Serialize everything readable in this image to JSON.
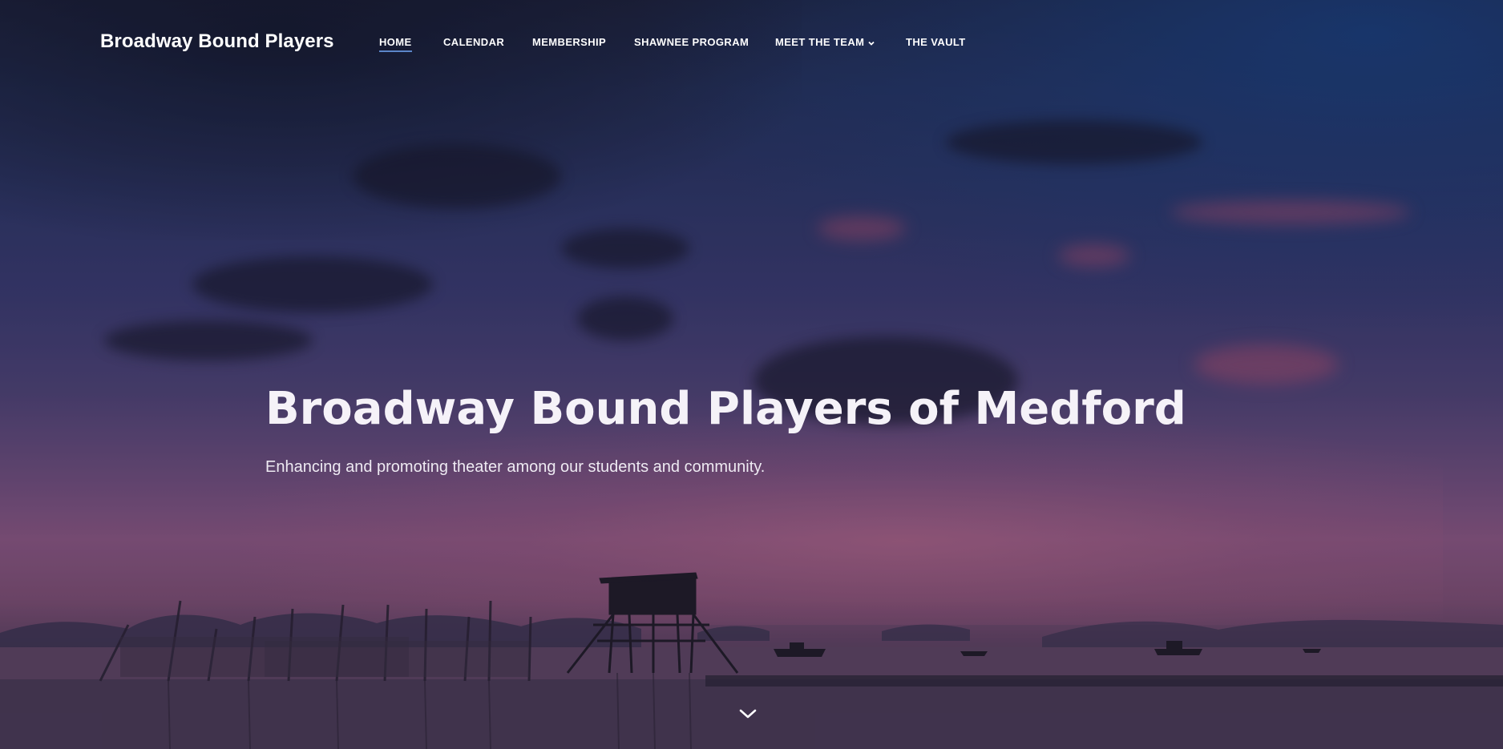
{
  "site": {
    "brand": "Broadway Bound Players"
  },
  "nav": {
    "items": [
      {
        "label": "HOME",
        "active": true
      },
      {
        "label": "CALENDAR",
        "active": false
      },
      {
        "label": "MEMBERSHIP",
        "active": false
      },
      {
        "label": "SHAWNEE PROGRAM",
        "active": false
      },
      {
        "label": "MEET THE TEAM",
        "active": false,
        "has_dropdown": true,
        "icon": "chevron-down-icon"
      },
      {
        "label": "THE VAULT",
        "active": false
      }
    ]
  },
  "hero": {
    "title": "Broadway Bound Players of Medford",
    "subtitle": "Enhancing and promoting theater among our students and community.",
    "scroll_icon": "chevron-down-icon"
  },
  "colors": {
    "text": "#ffffff",
    "active_underline": "#5b86c9",
    "sky_top": "#1d2340",
    "sky_horizon": "#8a5682"
  }
}
